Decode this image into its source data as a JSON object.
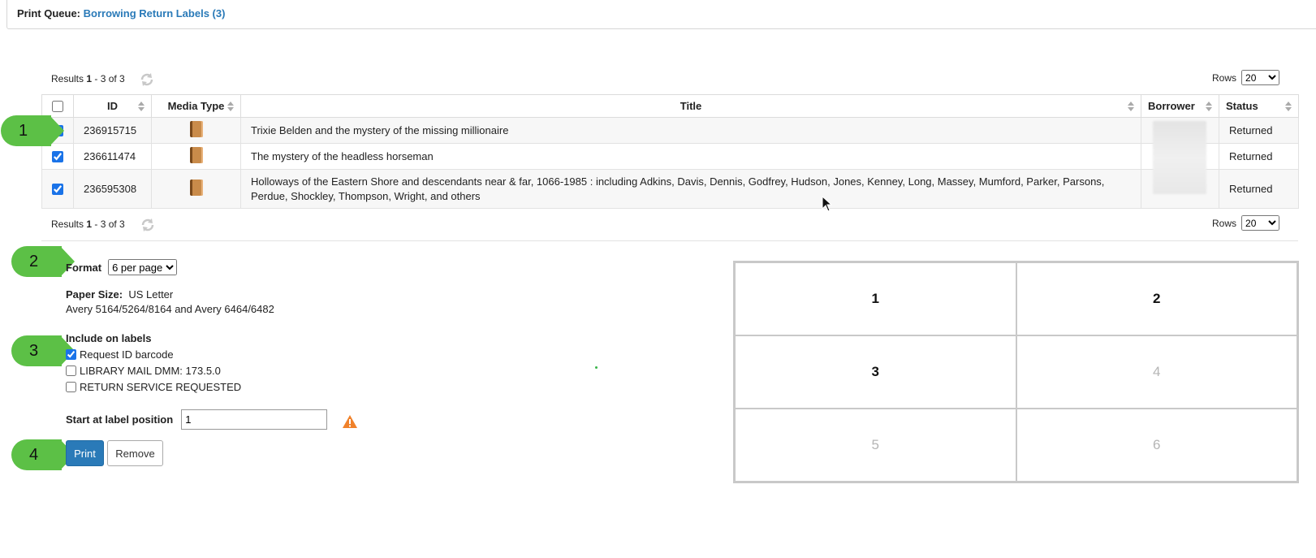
{
  "queue": {
    "label": "Print Queue:",
    "link": "Borrowing Return Labels (3)"
  },
  "results_top": {
    "prefix": "Results ",
    "from": "1",
    "rest": " - 3 of 3"
  },
  "results_bottom": {
    "prefix": "Results ",
    "from": "1",
    "rest": " - 3 of 3"
  },
  "rows_label": "Rows",
  "rows_value": "20",
  "table": {
    "headers": [
      "ID",
      "Media Type",
      "Title",
      "Borrower",
      "Status"
    ],
    "rows": [
      {
        "id": "236915715",
        "media": "book-icon",
        "title": "Trixie Belden and the mystery of the missing millionaire",
        "status": "Returned",
        "checked": true
      },
      {
        "id": "236611474",
        "media": "book-icon",
        "title": "The mystery of the headless horseman",
        "status": "Returned",
        "checked": true
      },
      {
        "id": "236595308",
        "media": "book-icon",
        "title": "Holloways of the Eastern Shore and descendants near & far, 1066-1985 : including Adkins, Davis, Dennis, Godfrey, Hudson, Jones, Kenney, Long, Massey, Mumford, Parker, Parsons, Perdue, Shockley, Thompson, Wright, and others",
        "status": "Returned",
        "checked": true
      }
    ]
  },
  "badges": [
    "1",
    "2",
    "3",
    "4"
  ],
  "format": {
    "label": "Format",
    "value": "6 per page"
  },
  "paper": {
    "label": "Paper Size:",
    "value": "US Letter",
    "avery": "Avery 5164/5264/8164 and Avery 6464/6482"
  },
  "include": {
    "heading": "Include on labels",
    "options": [
      {
        "label": "Request ID barcode",
        "checked": true
      },
      {
        "label": "LIBRARY MAIL DMM: 173.5.0",
        "checked": false
      },
      {
        "label": "RETURN SERVICE REQUESTED",
        "checked": false
      }
    ]
  },
  "start": {
    "label": "Start at label position",
    "value": "1"
  },
  "buttons": {
    "print": "Print",
    "remove": "Remove"
  },
  "label_positions": [
    "1",
    "2",
    "3",
    "4",
    "5",
    "6"
  ],
  "colors": {
    "accent": "#2a7ab8",
    "badge": "#5cc046",
    "warning": "#f0812a"
  }
}
